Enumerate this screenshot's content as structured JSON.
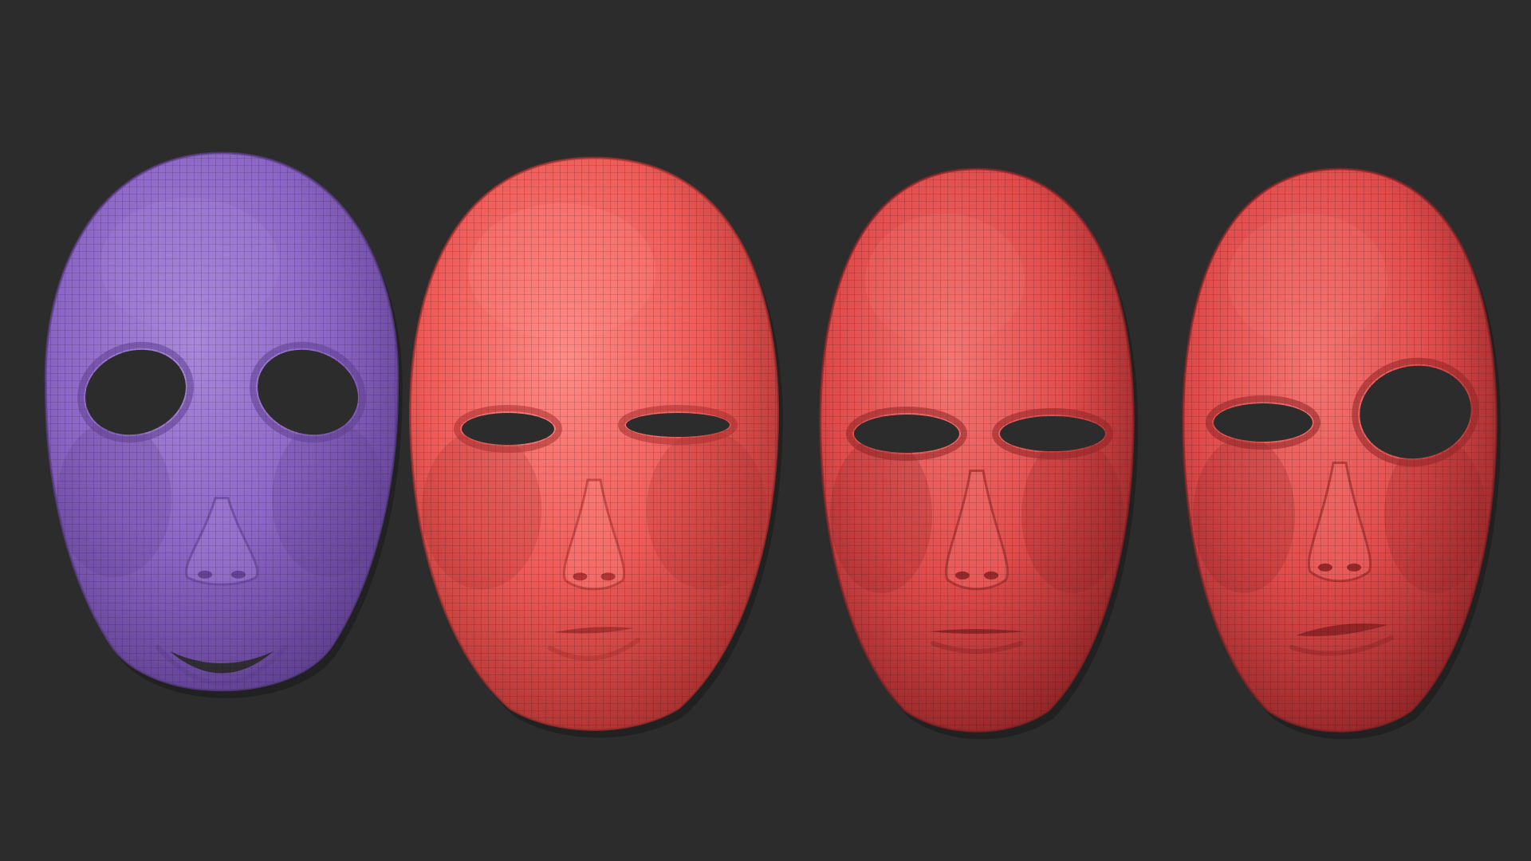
{
  "scene": {
    "background_color": "#2c2c2c",
    "hole_color": "#2c2c2c",
    "wire_color": "#1a0f12",
    "masks": [
      {
        "name": "smiling-mask",
        "color": "#8c66c6",
        "shade": "#5e3f8f",
        "highlight": "#a888da",
        "expression": "smile",
        "left_eye": "open",
        "right_eye": "open"
      },
      {
        "name": "squinting-mask",
        "color": "#ee5a57",
        "shade": "#a8302f",
        "highlight": "#ff8b86",
        "expression": "pursed",
        "left_eye": "open",
        "right_eye": "squint"
      },
      {
        "name": "neutral-mask",
        "color": "#e04b4b",
        "shade": "#8f2426",
        "highlight": "#f47672",
        "expression": "neutral",
        "left_eye": "open",
        "right_eye": "open"
      },
      {
        "name": "sneering-mask",
        "color": "#e04b4b",
        "shade": "#8f2426",
        "highlight": "#f47672",
        "expression": "sneer",
        "left_eye": "squint",
        "right_eye": "wide"
      }
    ]
  }
}
